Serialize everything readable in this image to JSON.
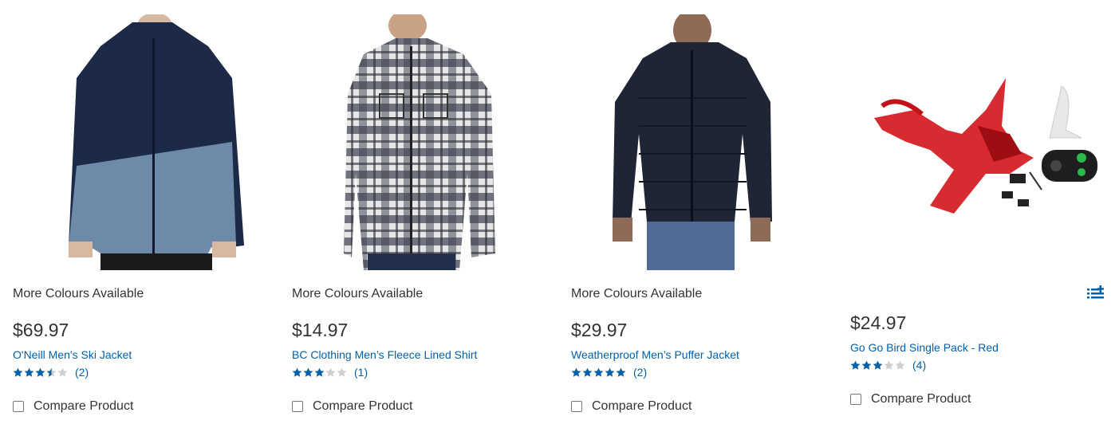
{
  "products": [
    {
      "more_colours": "More Colours Available",
      "price": "$69.97",
      "title": "O'Neill Men's Ski Jacket",
      "rating": 3.5,
      "review_count": "(2)",
      "compare_label": "Compare Product",
      "image_icon": "ski-jacket-product-image"
    },
    {
      "more_colours": "More Colours Available",
      "price": "$14.97",
      "title": "BC Clothing Men’s Fleece Lined Shirt",
      "rating": 3,
      "review_count": "(1)",
      "compare_label": "Compare Product",
      "image_icon": "flannel-shirt-product-image"
    },
    {
      "more_colours": "More Colours Available",
      "price": "$29.97",
      "title": "Weatherproof Men’s Puffer Jacket",
      "rating": 5,
      "review_count": "(2)",
      "compare_label": "Compare Product",
      "image_icon": "puffer-jacket-product-image"
    },
    {
      "more_colours": "",
      "price": "$24.97",
      "title": "Go Go Bird Single Pack - Red",
      "rating": 3,
      "review_count": "(4)",
      "compare_label": "Compare Product",
      "image_icon": "rc-bird-toy-product-image"
    }
  ],
  "colors": {
    "link": "#0060a9",
    "star": "#0060a9",
    "star_empty": "#cfcfcf",
    "text": "#333333"
  },
  "icons": {
    "add_to_list": "add-to-list-icon"
  }
}
